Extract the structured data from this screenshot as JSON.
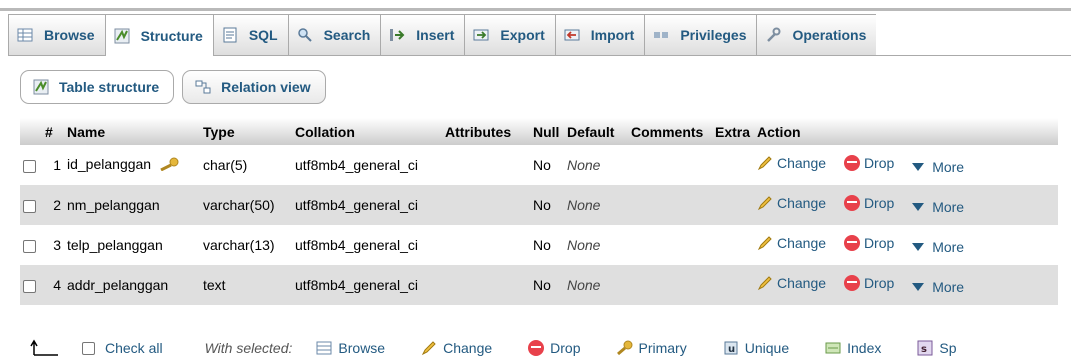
{
  "tabs": [
    {
      "label": "Browse",
      "icon": "browse-icon",
      "active": false
    },
    {
      "label": "Structure",
      "icon": "structure-icon",
      "active": true
    },
    {
      "label": "SQL",
      "icon": "sql-icon",
      "active": false
    },
    {
      "label": "Search",
      "icon": "search-icon",
      "active": false
    },
    {
      "label": "Insert",
      "icon": "insert-icon",
      "active": false
    },
    {
      "label": "Export",
      "icon": "export-icon",
      "active": false
    },
    {
      "label": "Import",
      "icon": "import-icon",
      "active": false
    },
    {
      "label": "Privileges",
      "icon": "privileges-icon",
      "active": false
    },
    {
      "label": "Operations",
      "icon": "operations-icon",
      "active": false
    }
  ],
  "subtabs": [
    {
      "label": "Table structure",
      "icon": "table-structure-icon"
    },
    {
      "label": "Relation view",
      "icon": "relation-view-icon"
    }
  ],
  "table": {
    "headers": {
      "num": "#",
      "name": "Name",
      "type": "Type",
      "collation": "Collation",
      "attributes": "Attributes",
      "null": "Null",
      "default": "Default",
      "comments": "Comments",
      "extra": "Extra",
      "action": "Action"
    },
    "rows": [
      {
        "num": "1",
        "name": "id_pelanggan",
        "primary_key": true,
        "type": "char(5)",
        "collation": "utf8mb4_general_ci",
        "attributes": "",
        "null": "No",
        "default": "None",
        "comments": "",
        "extra": ""
      },
      {
        "num": "2",
        "name": "nm_pelanggan",
        "primary_key": false,
        "type": "varchar(50)",
        "collation": "utf8mb4_general_ci",
        "attributes": "",
        "null": "No",
        "default": "None",
        "comments": "",
        "extra": ""
      },
      {
        "num": "3",
        "name": "telp_pelanggan",
        "primary_key": false,
        "type": "varchar(13)",
        "collation": "utf8mb4_general_ci",
        "attributes": "",
        "null": "No",
        "default": "None",
        "comments": "",
        "extra": ""
      },
      {
        "num": "4",
        "name": "addr_pelanggan",
        "primary_key": false,
        "type": "text",
        "collation": "utf8mb4_general_ci",
        "attributes": "",
        "null": "No",
        "default": "None",
        "comments": "",
        "extra": ""
      }
    ],
    "actions": {
      "change": "Change",
      "drop": "Drop",
      "more": "More"
    }
  },
  "bottom": {
    "check_all": "Check all",
    "with_selected": "With selected:",
    "items": [
      "Browse",
      "Change",
      "Drop",
      "Primary",
      "Unique",
      "Index",
      "Sp"
    ]
  },
  "colors": {
    "link": "#235a81",
    "row_even": "#dfdfdf",
    "drop_red": "#e8414b",
    "key_gold": "#e5b73b"
  }
}
